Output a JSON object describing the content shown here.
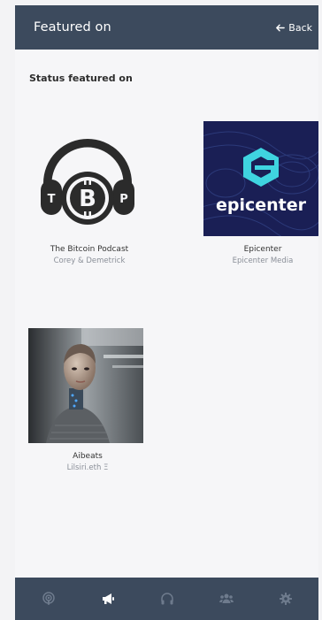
{
  "header": {
    "title": "Featured on",
    "back_label": "Back"
  },
  "section": {
    "title": "Status featured on"
  },
  "cards": [
    {
      "name": "The Bitcoin Podcast",
      "author": "Corey & Demetrick",
      "art": "headphones-bitcoin-logo",
      "logo_letters": [
        "T",
        "P"
      ]
    },
    {
      "name": "Epicenter",
      "author": "Epicenter Media",
      "art": "epicenter-logo",
      "logo_text": "epicenter"
    },
    {
      "name": "Aibeats",
      "author": "Lilsiri.eth Ξ",
      "art": "android-portrait-photo"
    }
  ],
  "nav": [
    {
      "icon": "podcast-icon",
      "active": false
    },
    {
      "icon": "megaphone-icon",
      "active": true
    },
    {
      "icon": "headphones-icon",
      "active": false
    },
    {
      "icon": "users-icon",
      "active": false
    },
    {
      "icon": "gear-icon",
      "active": false
    }
  ],
  "colors": {
    "header_bg": "#3c4a5d",
    "nav_inactive": "#6e7b8d",
    "nav_active": "#ffffff",
    "epicenter_bg": "#1a1f55",
    "epicenter_accent": "#3fd4e0"
  }
}
